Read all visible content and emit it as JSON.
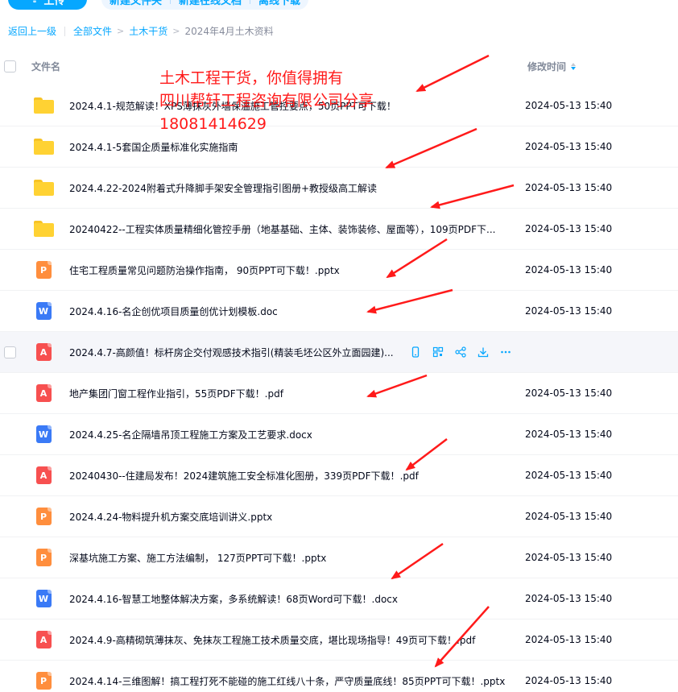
{
  "toolbar": {
    "upload_label": "上传",
    "new_folder_label": "新建文件夹",
    "new_online_doc_label": "新建在线文档",
    "offline_download_label": "离线下载"
  },
  "breadcrumb": {
    "back": "返回上一级",
    "all_files": "全部文件",
    "level1": "土木干货",
    "current": "2024年4月土木资料",
    "sep": ">"
  },
  "header": {
    "name": "文件名",
    "modified": "修改时间"
  },
  "overlay": {
    "line1": "土木工程干货，你值得拥有",
    "line2": "四川帮轩工程咨询有限公司分享",
    "line3": "18081414629",
    "color": "#ff1a1a"
  },
  "files": [
    {
      "type": "folder",
      "name": "2024.4.1-规范解读！XPS薄抹灰外墙保温施工管控要点，50页PPT可下载！",
      "time": "2024-05-13 15:40"
    },
    {
      "type": "folder",
      "name": "2024.4.1-5套国企质量标准化实施指南",
      "time": "2024-05-13 15:40"
    },
    {
      "type": "folder",
      "name": "2024.4.22-2024附着式升降脚手架安全管理指引图册+教授级高工解读",
      "time": "2024-05-13 15:40"
    },
    {
      "type": "folder",
      "name": "20240422--工程实体质量精细化管控手册（地基基础、主体、装饰装修、屋面等），109页PDF下...",
      "time": "2024-05-13 15:40"
    },
    {
      "type": "ppt",
      "name": "住宅工程质量常见问题防治操作指南， 90页PPT可下载！.pptx",
      "time": "2024-05-13 15:40"
    },
    {
      "type": "word",
      "name": "2024.4.16-名企创优项目质量创优计划模板.doc",
      "time": "2024-05-13 15:40"
    },
    {
      "type": "pdf",
      "name": "2024.4.7-高颜值！标杆房企交付观感技术指引(精装毛坯公区外立面园建)...",
      "time": "",
      "hover": true
    },
    {
      "type": "pdf",
      "name": "地产集团门窗工程作业指引，55页PDF下载！.pdf",
      "time": "2024-05-13 15:40"
    },
    {
      "type": "word",
      "name": "2024.4.25-名企隔墙吊顶工程施工方案及工艺要求.docx",
      "time": "2024-05-13 15:40"
    },
    {
      "type": "pdf",
      "name": "20240430--住建局发布！2024建筑施工安全标准化图册，339页PDF下载！.pdf",
      "time": "2024-05-13 15:40"
    },
    {
      "type": "ppt",
      "name": "2024.4.24-物料提升机方案交底培训讲义.pptx",
      "time": "2024-05-13 15:40"
    },
    {
      "type": "ppt",
      "name": "深基坑施工方案、施工方法编制， 127页PPT可下载！.pptx",
      "time": "2024-05-13 15:40"
    },
    {
      "type": "word",
      "name": "2024.4.16-智慧工地整体解决方案，多系统解读！68页Word可下载！.docx",
      "time": "2024-05-13 15:40"
    },
    {
      "type": "pdf",
      "name": "2024.4.9-高精砌筑薄抹灰、免抹灰工程施工技术质量交底，堪比现场指导！49页可下载！.pdf",
      "time": "2024-05-13 15:40"
    },
    {
      "type": "ppt",
      "name": "2024.4.14-三维图解！搞工程打死不能碰的施工红线八十条，严守质量底线！85页PPT可下载！.pptx",
      "time": "2024-05-13 15:40"
    }
  ],
  "icon_letters": {
    "ppt": "P",
    "word": "W",
    "pdf": "A"
  },
  "row_action_icons": [
    "phone-icon",
    "qr-icon",
    "share-icon",
    "download-icon",
    "more-icon"
  ],
  "colors": {
    "accent": "#06a7ff",
    "folder": "#ffd233",
    "ppt": "#ff8e3d",
    "word": "#3a7af6",
    "pdf": "#f75050",
    "arrow": "#ff1a1a"
  }
}
